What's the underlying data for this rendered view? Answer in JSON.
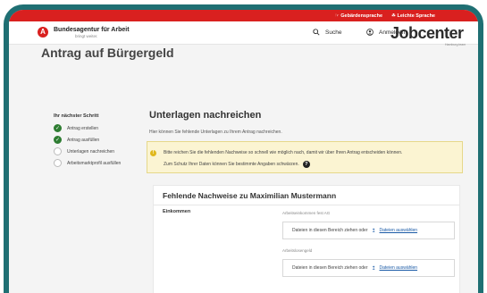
{
  "topbar": {
    "gebaerdensprache": "Gebärdensprache",
    "leichte_sprache": "Leichte Sprache"
  },
  "header": {
    "logo_letter": "A",
    "brand": "Bundesagentur für Arbeit",
    "brand_sub": "bringt weiter.",
    "search_label": "Suche",
    "login_label": "Anmelden"
  },
  "page": {
    "title": "Antrag auf Bürgergeld",
    "jobcenter": "Jobcenter",
    "jobcenter_sub": "Hamburg.team"
  },
  "steps": {
    "title": "Ihr nächster Schritt",
    "items": [
      {
        "label": "Antrag erstellen",
        "status": "done"
      },
      {
        "label": "Antrag ausfüllen",
        "status": "done"
      },
      {
        "label": "Unterlagen nachreichen",
        "status": "open"
      },
      {
        "label": "Arbeitsmarktprofil ausfüllen",
        "status": "open"
      }
    ]
  },
  "content": {
    "title": "Unterlagen nachreichen",
    "subtitle": "Hier können Sie fehlende Unterlagen zu Ihrem Antrag nachreichen.",
    "notice_line1": "Bitte reichen Sie die fehlenden Nachweise so schnell wie möglich nach, damit wir über Ihren Antrag entscheiden können.",
    "notice_line2": "Zum Schutz Ihrer Daten können Sie bestimmte Angaben schwärzen."
  },
  "card": {
    "title": "Fehlende Nachweise zu Maximilian Mustermann",
    "section": "Einkommen",
    "fields": [
      {
        "label": "Arbeitseinkommen fest AG",
        "drop_text": "Dateien in diesen Bereich ziehen oder",
        "link": "Dateien auswählen"
      },
      {
        "label": "Arbeitslosengeld",
        "drop_text": "Dateien in diesen Bereich ziehen oder",
        "link": "Dateien auswählen"
      }
    ]
  },
  "colors": {
    "accent_red": "#d9201f",
    "frame_teal": "#1f6f73",
    "success_green": "#2e7d32",
    "notice_yellow": "#fbf4d2"
  }
}
